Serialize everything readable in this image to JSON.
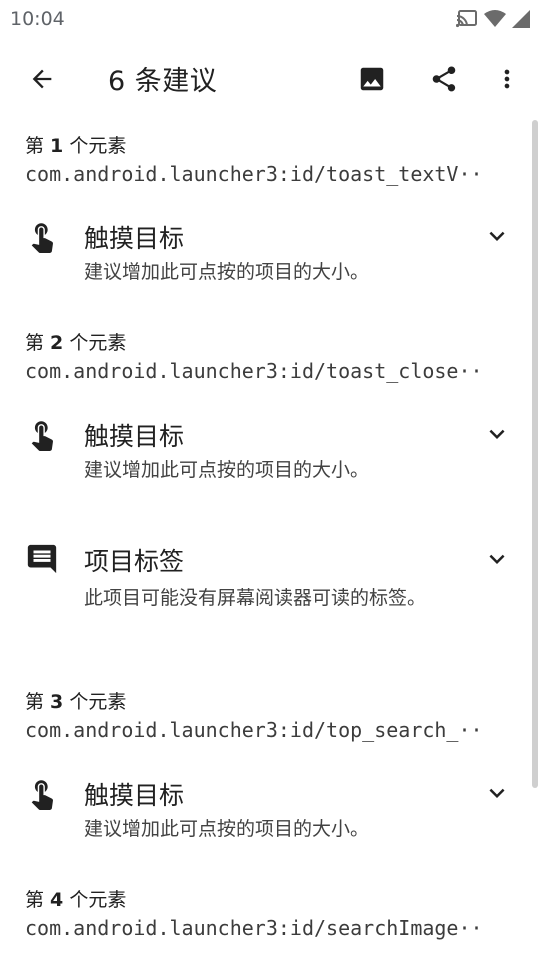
{
  "status": {
    "time": "10:04"
  },
  "toolbar": {
    "title": "6 条建议"
  },
  "elements": [
    {
      "label_prefix": "第 ",
      "index": "1",
      "label_suffix": " 个元素",
      "id": "com.android.launcher3:id/toast_textV··"
    },
    {
      "label_prefix": "第 ",
      "index": "2",
      "label_suffix": " 个元素",
      "id": "com.android.launcher3:id/toast_close··"
    },
    {
      "label_prefix": "第 ",
      "index": "3",
      "label_suffix": " 个元素",
      "id": "com.android.launcher3:id/top_search_··"
    },
    {
      "label_prefix": "第 ",
      "index": "4",
      "label_suffix": " 个元素",
      "id": "com.android.launcher3:id/searchImage··"
    }
  ],
  "suggestions": [
    {
      "title": "触摸目标",
      "desc": "建议增加此可点按的项目的大小。",
      "icon": "touch-target-icon"
    },
    {
      "title": "触摸目标",
      "desc": "建议增加此可点按的项目的大小。",
      "icon": "touch-target-icon"
    },
    {
      "title": "项目标签",
      "desc": "此项目可能没有屏幕阅读器可读的标签。",
      "icon": "comment-icon"
    },
    {
      "title": "触摸目标",
      "desc": "建议增加此可点按的项目的大小。",
      "icon": "touch-target-icon"
    }
  ]
}
